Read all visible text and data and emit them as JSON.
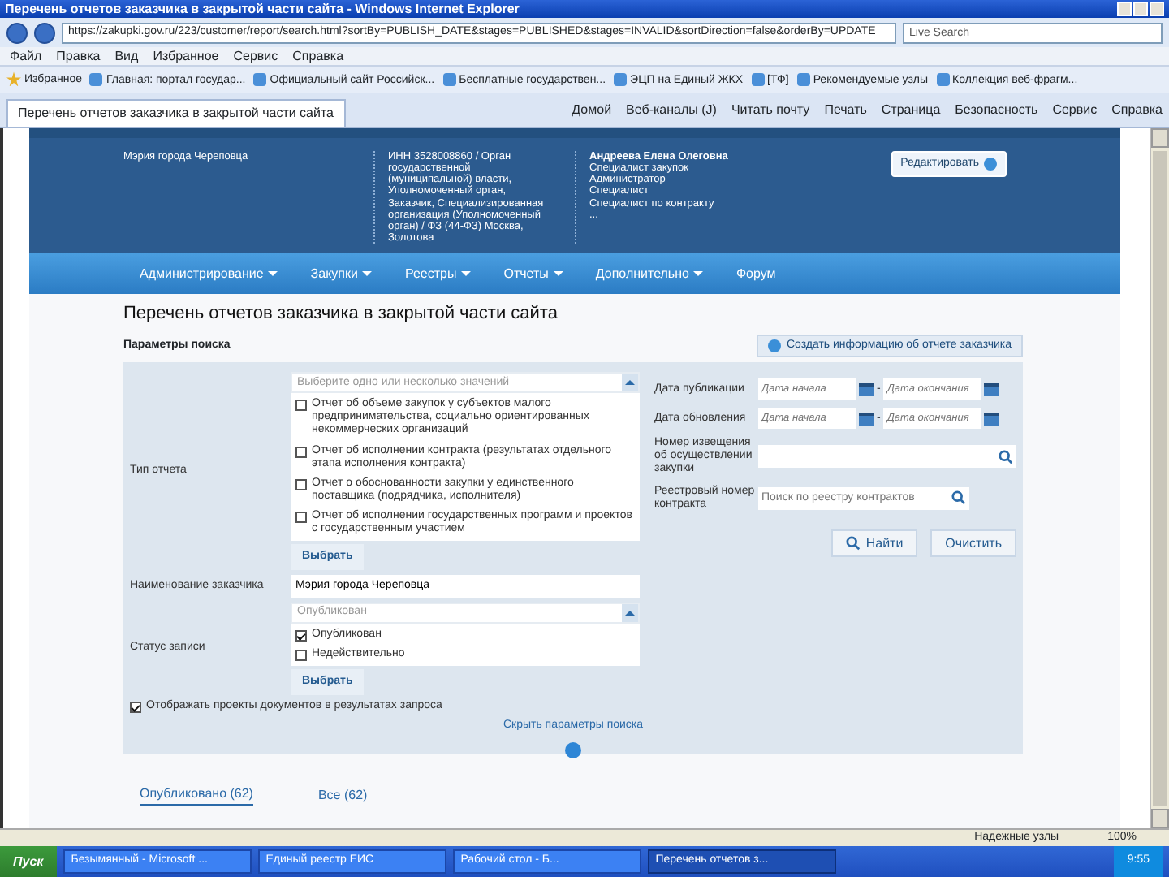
{
  "window": {
    "title": "Перечень отчетов заказчика в закрытой части сайта - Windows Internet Explorer"
  },
  "address_bar": {
    "url": "https://zakupki.gov.ru/223/customer/report/search.html?sortBy=PUBLISH_DATE&stages=PUBLISHED&stages=INVALID&sortDirection=false&orderBy=UPDATE",
    "search_placeholder": "Live Search"
  },
  "menu": [
    "Файл",
    "Правка",
    "Вид",
    "Избранное",
    "Сервис",
    "Справка"
  ],
  "favorites": [
    {
      "label": "Избранное"
    },
    {
      "label": "Главная: портал государ..."
    },
    {
      "label": "Официальный сайт Российск..."
    },
    {
      "label": "Бесплатные государствен..."
    },
    {
      "label": "ЭЦП на Единый ЖКХ"
    },
    {
      "label": "[ТФ]"
    },
    {
      "label": "Рекомендуемые узлы"
    },
    {
      "label": "Коллекция веб-фрагм..."
    }
  ],
  "browser_tab": {
    "title": "Перечень отчетов заказчика в закрытой части сайта"
  },
  "command_bar": [
    "Домой",
    "Веб-каналы (J)",
    "Читать почту",
    "Печать",
    "Страница",
    "Безопасность",
    "Сервис",
    "Справка"
  ],
  "header": {
    "organization": "Мэрия города Череповца",
    "org_details": "ИНН 3528008860 / Орган государственной (муниципальной) власти, Уполномоченный орган, Заказчик, Специализированная организация (Уполномоченный орган) / ФЗ (44-ФЗ) Москва, Золотова",
    "user_name": "Андреева Елена Олеговна",
    "user_roles": [
      "Специалист закупок",
      "Администратор",
      "Специалист",
      "Специалист по контракту",
      "..."
    ],
    "edit_button": "Редактировать"
  },
  "nav": [
    {
      "label": "Администрирование",
      "dropdown": true
    },
    {
      "label": "Закупки",
      "dropdown": true
    },
    {
      "label": "Реестры",
      "dropdown": true
    },
    {
      "label": "Отчеты",
      "dropdown": true
    },
    {
      "label": "Дополнительно",
      "dropdown": true
    },
    {
      "label": "Форум",
      "dropdown": false
    }
  ],
  "page_title": "Перечень отчетов заказчика в закрытой части сайта",
  "search_params_label": "Параметры поиска",
  "create_button": "Создать информацию об отчете заказчика",
  "search_form": {
    "report_type": {
      "label": "Тип отчета",
      "placeholder": "Выберите одно или несколько значений",
      "options": [
        {
          "label": "Отчет об объеме закупок у субъектов малого предпринимательства, социально ориентированных некоммерческих организаций",
          "checked": false
        },
        {
          "label": "Отчет об исполнении контракта (результатах отдельного этапа исполнения контракта)",
          "checked": false
        },
        {
          "label": "Отчет о обоснованности закупки у единственного поставщика (подрядчика, исполнителя)",
          "checked": false
        },
        {
          "label": "Отчет об исполнении государственных программ и проектов с государственным участием",
          "checked": false
        }
      ],
      "select_button": "Выбрать"
    },
    "customer": {
      "label": "Наименование заказчика",
      "value": "Мэрия города Череповца"
    },
    "status": {
      "label": "Статус записи",
      "placeholder": "Опубликован",
      "options": [
        {
          "label": "Опубликован",
          "checked": true
        },
        {
          "label": "Недействительно",
          "checked": false
        }
      ],
      "select_button": "Выбрать"
    },
    "show_drafts": {
      "label": "Отображать проекты документов в результатах запроса",
      "checked": true
    },
    "publish_date": {
      "label": "Дата публикации",
      "from_placeholder": "Дата начала",
      "separator": "-",
      "to_placeholder": "Дата окончания"
    },
    "update_date": {
      "label": "Дата обновления",
      "from_placeholder": "Дата начала",
      "separator": "-",
      "to_placeholder": "Дата окончания"
    },
    "notice_number": {
      "label": "Номер извещения об осуществлении закупки"
    },
    "contract_number": {
      "label": "Реестровый номер контракта",
      "placeholder": "Поиск по реестру контрактов"
    },
    "find_button": "Найти",
    "clear_button": "Очистить",
    "hide_link": "Скрыть параметры поиска"
  },
  "result_tabs": [
    {
      "label": "Опубликовано (62)",
      "selected": true
    },
    {
      "label": "Все (62)",
      "selected": false
    }
  ],
  "status_bar": {
    "zone": "Надежные узлы",
    "zoom": "100%"
  },
  "taskbar": {
    "start": "Пуск",
    "tasks": [
      {
        "label": "Безымянный - Microsoft ...",
        "selected": false
      },
      {
        "label": "Единый реестр ЕИС",
        "selected": false
      },
      {
        "label": "Рабочий стол - Б...",
        "selected": false
      },
      {
        "label": "Перечень отчетов з...",
        "selected": true
      }
    ],
    "clock": "9:55"
  }
}
